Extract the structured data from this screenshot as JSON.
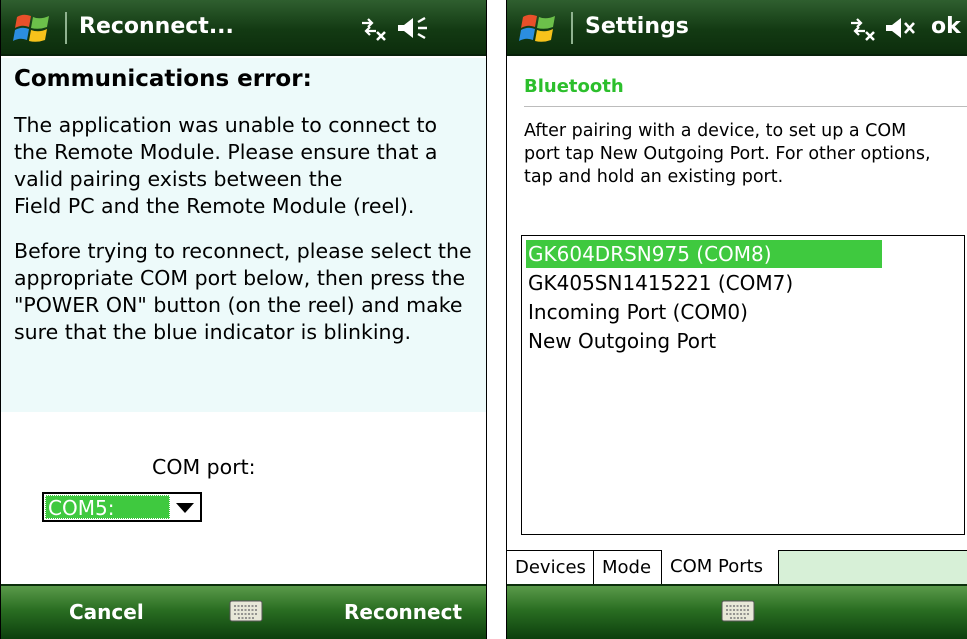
{
  "left": {
    "title": "Reconnect...",
    "heading": "Communications error:",
    "paragraph1": "The application was unable to connect to\nthe Remote Module. Please ensure that a\nvalid               pairing exists between the\nField PC and the Remote Module (reel).",
    "paragraph2": "Before trying to reconnect, please select the\nappropriate COM port below, then press the\n\"POWER ON\" button (on the reel) and make\nsure that the blue indicator is blinking.",
    "com_label": "COM port:",
    "com_value": "COM5:",
    "softkeys": {
      "left": "Cancel",
      "right": "Reconnect"
    }
  },
  "right": {
    "title": "Settings",
    "ok": "ok",
    "section": "Bluetooth",
    "description": "After pairing with a device, to set up a COM\nport tap New Outgoing Port. For other options,\ntap and hold an existing port.",
    "ports": [
      "GK604DRSN975 (COM8)",
      "GK405SN1415221 (COM7)",
      "Incoming Port (COM0)",
      "New Outgoing Port"
    ],
    "selected_index": 0,
    "tabs": [
      "Devices",
      "Mode",
      "COM Ports"
    ],
    "active_tab": "COM Ports"
  },
  "icons": [
    "windows-logo-icon",
    "connectivity-icon",
    "volume-icon",
    "volume-muted-icon",
    "keyboard-icon"
  ],
  "colors": {
    "titlebar": "#133a13",
    "selection": "#3fc93f",
    "section_title": "#2cbf2c",
    "content_bg": "#edfafa"
  }
}
